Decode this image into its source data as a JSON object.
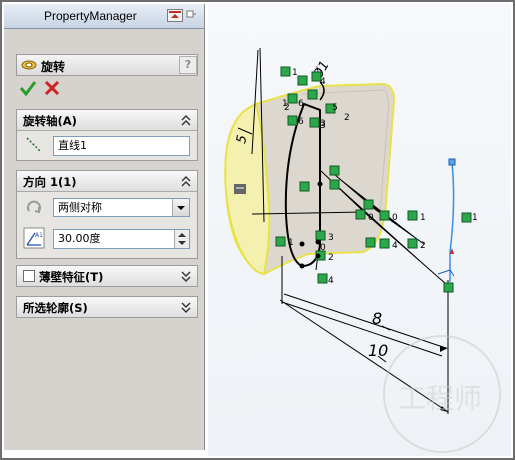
{
  "panel": {
    "title": "PropertyManager",
    "feature_name": "旋转",
    "help": "?",
    "groups": {
      "axis": {
        "title": "旋转轴(A)",
        "value": "直线1"
      },
      "direction": {
        "title": "方向 1(1)",
        "type": "两侧对称",
        "angle": "30.00度"
      },
      "thin": {
        "title": "薄壁特征(T)"
      },
      "contours": {
        "title": "所选轮廓(S)"
      }
    }
  },
  "canvas": {
    "dims": [
      "8",
      "10",
      "5",
      "Ø1"
    ],
    "relation_labels": [
      "1",
      "4",
      "1",
      "6",
      "5",
      "2",
      "3",
      "2",
      "6",
      "3",
      "0",
      "1",
      "4",
      "2",
      "1",
      "0",
      "3",
      "2",
      "4",
      "0",
      "1"
    ],
    "watermark": "工程师",
    "colors": {
      "sketch_green": "#2aa84a",
      "dim_line": "#000000",
      "highlight": "#f3ec3c"
    }
  }
}
